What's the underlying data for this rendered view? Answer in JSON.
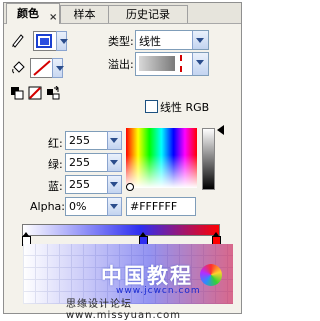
{
  "tabs": [
    {
      "label": "颜色",
      "active": true
    },
    {
      "label": "样本",
      "active": false
    },
    {
      "label": "历史记录",
      "active": false
    }
  ],
  "tab_close_glyph": "×",
  "tools": {
    "stroke_icon": "pencil-icon",
    "fill_icon": "paint-bucket-icon",
    "bw_icon": "black-white-icon",
    "none_icon": "no-color-icon",
    "swap_icon": "swap-colors-icon"
  },
  "type": {
    "label": "类型:",
    "value": "线性"
  },
  "overflow": {
    "label": "溢出:"
  },
  "linear_rgb": {
    "label": "线性 RGB",
    "checked": false
  },
  "channels": {
    "red": {
      "label": "红:",
      "value": "255"
    },
    "green": {
      "label": "绿:",
      "value": "255"
    },
    "blue": {
      "label": "蓝:",
      "value": "255"
    },
    "alpha": {
      "label": "Alpha:",
      "value": "0%"
    }
  },
  "hex_value": "#FFFFFF",
  "watermark": {
    "title": "中国教程",
    "url": "www.jcwcn.com",
    "footer": "思缘设计论坛 www.missyuan.com"
  },
  "colors": {
    "accent": "#2b4d8c",
    "gradient_start": "#ffffff",
    "gradient_mid": "#2e2ef0",
    "gradient_end": "#ff0000"
  }
}
